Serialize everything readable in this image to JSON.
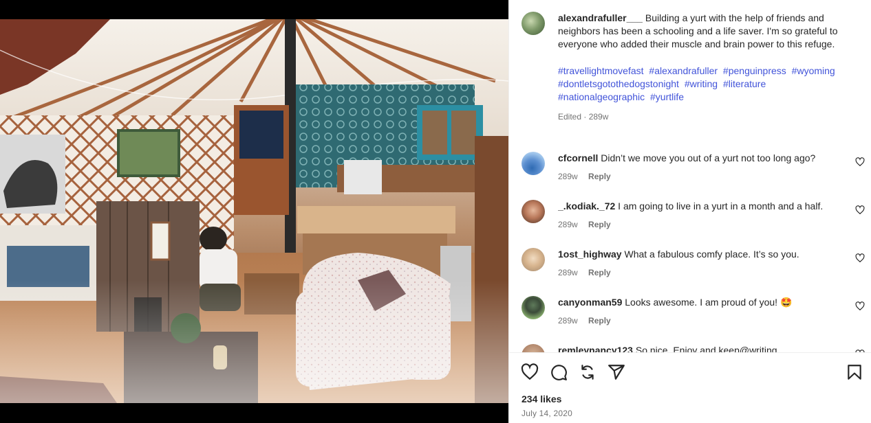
{
  "post": {
    "author": "alexandrafuller___",
    "caption": "Building a yurt with the help of friends and neighbors has been a schooling and a life saver. I'm so grateful to everyone who added their muscle and brain power to this refuge.",
    "hashtags": [
      "#travellightmovefast",
      "#alexandrafuller",
      "#penguinpress",
      "#wyoming",
      "#dontletsgotothedogstonight",
      "#writing",
      "#literature",
      "#nationalgeographic",
      "#yurtlife"
    ],
    "edited_label": "Edited",
    "edited_time": "289w"
  },
  "comments": [
    {
      "user": "cfcornell",
      "text": "Didn’t we move you out of a yurt not too long ago?",
      "time": "289w",
      "reply": "Reply",
      "avatar": "av1"
    },
    {
      "user": "_.kodiak._72",
      "text": "I am going to live in a yurt in a month and a half.",
      "time": "289w",
      "reply": "Reply",
      "avatar": "av2"
    },
    {
      "user": "1ost_highway",
      "text": "What a fabulous comfy place. It’s so you.",
      "time": "289w",
      "reply": "Reply",
      "avatar": "av3"
    },
    {
      "user": "canyonman59",
      "text": "Looks awesome. I am proud of you! 🤩",
      "time": "289w",
      "reply": "Reply",
      "avatar": "av4"
    },
    {
      "user": "remleynancy123",
      "text": "So nice. Enjoy and keep@writing",
      "time": "",
      "reply": "",
      "avatar": "av5"
    }
  ],
  "actions": {
    "like_icon": "heart-outline-icon",
    "comment_icon": "speech-bubble-icon",
    "share_icon": "repost-icon",
    "send_icon": "paper-plane-icon",
    "save_icon": "bookmark-icon"
  },
  "likes": "234 likes",
  "date": "July 14, 2020",
  "colors": {
    "hashtag": "#4153d9",
    "muted": "#737373",
    "text": "#262626"
  }
}
